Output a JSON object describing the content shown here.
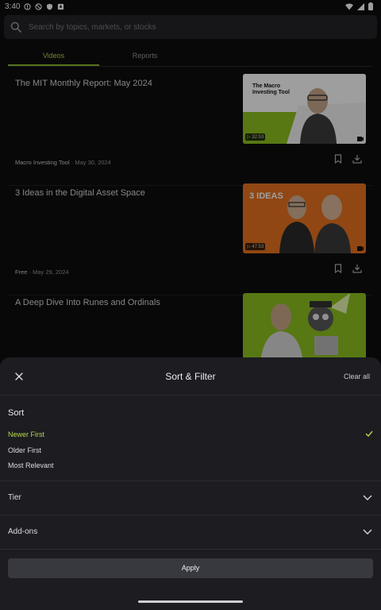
{
  "status_bar": {
    "time": "3:40",
    "icons": [
      "notification-icon",
      "blocked-icon",
      "shield-icon",
      "download-notification-icon",
      "wifi-icon",
      "signal-icon",
      "battery-icon"
    ]
  },
  "search": {
    "placeholder": "Search by topics, markets, or stocks"
  },
  "tabs": [
    {
      "label": "Videos",
      "active": true
    },
    {
      "label": "Reports",
      "active": false
    }
  ],
  "videos": [
    {
      "title": "The MIT Monthly Report: May 2024",
      "source": "Macro Investing Tool",
      "date": "May 30, 2024",
      "duration": "32:53",
      "thumb_title": "The Macro Investing Tool"
    },
    {
      "title": "3 Ideas in the Digital Asset Space",
      "source": "Free",
      "date": "May 29, 2024",
      "duration": "47:53",
      "thumb_title": "3 IDEAS"
    },
    {
      "title": "A Deep Dive Into Runes and Ordinals",
      "source": "",
      "date": "",
      "duration": "",
      "thumb_title": ""
    }
  ],
  "sheet": {
    "title": "Sort & Filter",
    "clear_label": "Clear all",
    "sort_label": "Sort",
    "sort_options": [
      {
        "label": "Newer First",
        "selected": true
      },
      {
        "label": "Older First",
        "selected": false
      },
      {
        "label": "Most Relevant",
        "selected": false
      }
    ],
    "sections": [
      {
        "label": "Tier"
      },
      {
        "label": "Add-ons"
      }
    ],
    "apply_label": "Apply"
  },
  "colors": {
    "accent": "#b6d94a",
    "background": "#0d0d10",
    "sheet": "#1c1c21"
  }
}
